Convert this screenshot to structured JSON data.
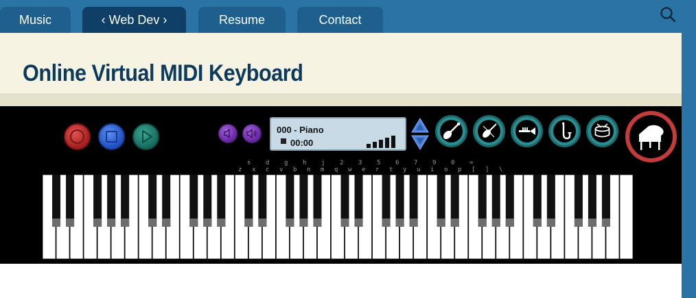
{
  "nav": {
    "tabs": [
      {
        "label": "Music"
      },
      {
        "label": "‹ Web Dev ›"
      },
      {
        "label": "Resume"
      },
      {
        "label": "Contact"
      }
    ],
    "search_icon": "search-icon"
  },
  "page": {
    "title": "Online Virtual MIDI Keyboard"
  },
  "player": {
    "patch": "000 - Piano",
    "time": "00:00",
    "volume_levels": [
      0.3,
      0.45,
      0.6,
      0.75,
      0.9
    ]
  },
  "instruments": [
    "guitar-icon",
    "violin-icon",
    "trumpet-icon",
    "saxophone-icon",
    "drum-icon",
    "grand-piano-icon"
  ],
  "key_labels": {
    "upper_row": [
      "s",
      "d",
      "g",
      "h",
      "j",
      "2",
      "3",
      "5",
      "6",
      "7",
      "9",
      "0",
      "="
    ],
    "lower_row": [
      "z",
      "x",
      "c",
      "v",
      "b",
      "n",
      "m",
      "q",
      "w",
      "e",
      "r",
      "t",
      "y",
      "u",
      "i",
      "o",
      "p",
      "[",
      "]",
      "\\"
    ]
  },
  "colors": {
    "nav_bg": "#2a74a5",
    "tab_bg": "#1e5f8d",
    "tab_active_bg": "#0f3f66",
    "title_band": "#f6f3e3",
    "title_text": "#0c3a5b",
    "record": "#b22222",
    "stop": "#2f63d6",
    "play": "#1f7f6e",
    "volume": "#7a33b8",
    "instrument_ring": "#2a8f92",
    "piano_ring": "#c33b3b"
  }
}
